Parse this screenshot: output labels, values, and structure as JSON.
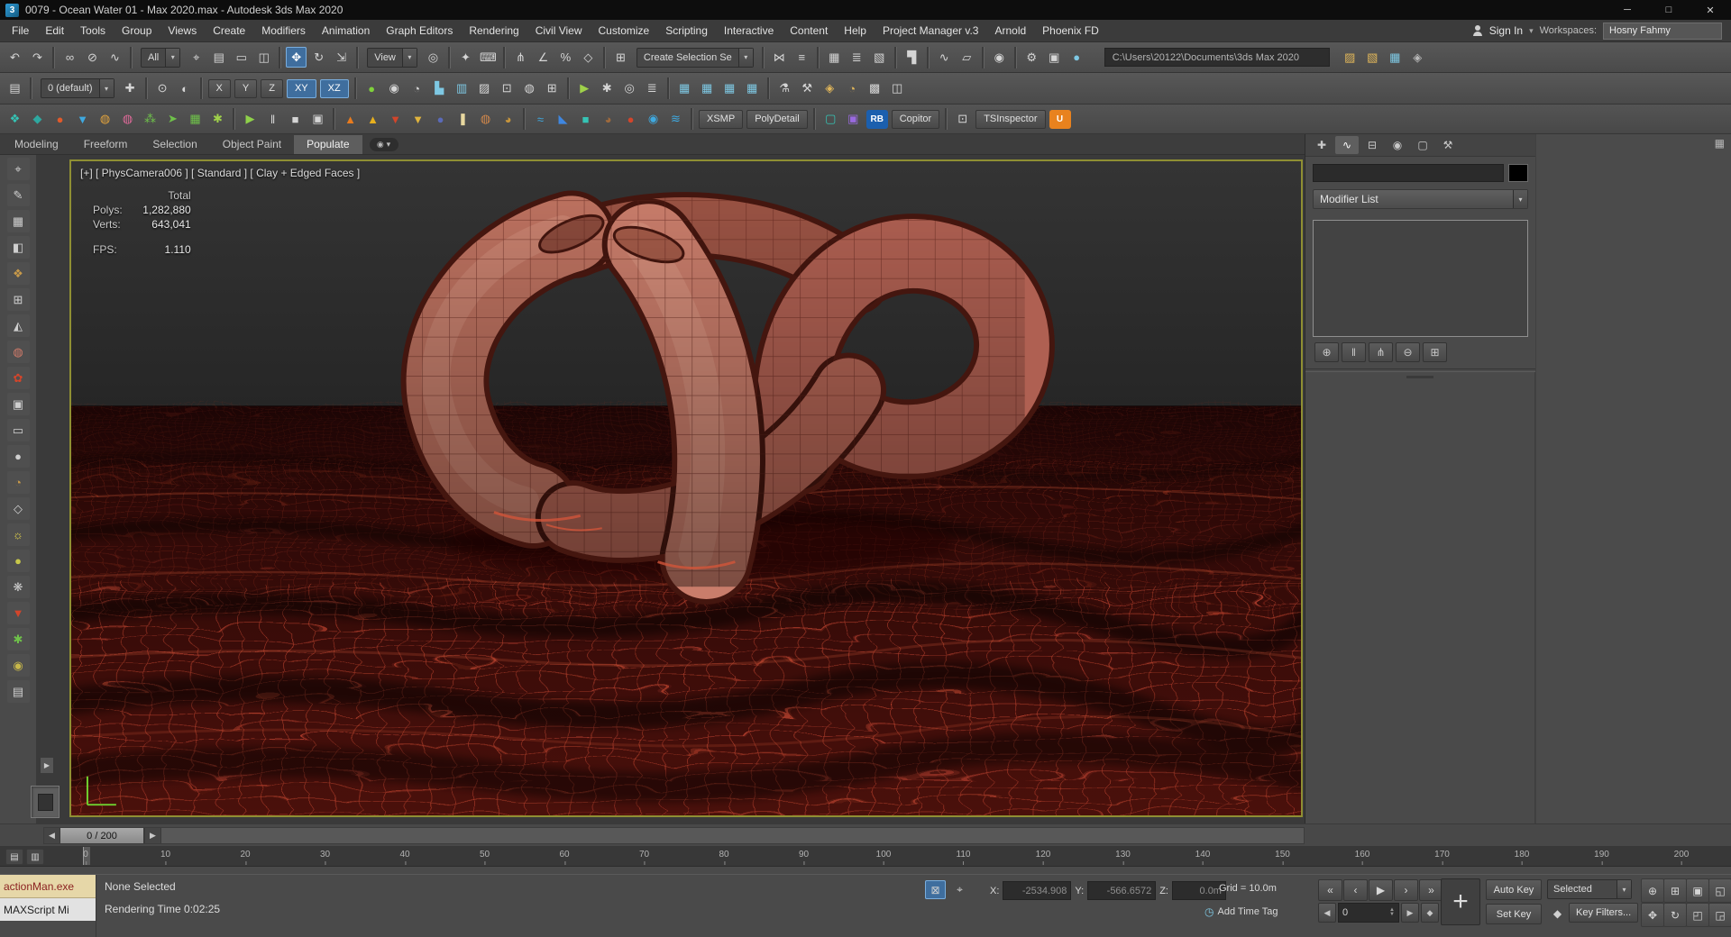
{
  "title_bar": {
    "title": "0079 - Ocean Water 01 - Max 2020.max - Autodesk 3ds Max 2020",
    "logo_glyph": "3"
  },
  "menu_bar": {
    "sign_in": "Sign In",
    "workspaces_label": "Workspaces:",
    "workspace_value": "Hosny Fahmy"
  },
  "toolbar": {
    "filter_value": "All",
    "ref_coord": "View",
    "named_sel": "Create Selection Se",
    "layer": "0 (default)",
    "path": "C:\\Users\\20122\\Documents\\3ds Max 2020"
  },
  "viewport": {
    "header": "[+] [ PhysCamera006 ] [ Standard ] [ Clay + Edged Faces ]",
    "stats": {
      "total_label": "Total",
      "polys_label": "Polys:",
      "polys": "1,282,880",
      "verts_label": "Verts:",
      "verts": "643,041",
      "fps_label": "FPS:",
      "fps": "1.110"
    }
  },
  "command_panel": {
    "modifier_list": "Modifier List"
  },
  "time_slider": {
    "value": "0 / 200"
  },
  "timeline": {
    "ticks": [
      "0",
      "10",
      "20",
      "30",
      "40",
      "50",
      "60",
      "70",
      "80",
      "90",
      "100",
      "110",
      "120",
      "130",
      "140",
      "150",
      "160",
      "170",
      "180",
      "190",
      "200"
    ]
  },
  "status_bar": {
    "listener_line1": "actionMan.exe",
    "listener_line2": "MAXScript Mi",
    "selection": "None Selected",
    "render_time": "Rendering Time 0:02:25",
    "x_label": "X:",
    "x_value": "-2534.908",
    "y_label": "Y:",
    "y_value": "-566.6572",
    "z_label": "Z:",
    "z_value": "0.0m",
    "grid_text": "Grid = 10.0m",
    "add_time_tag": "Add Time Tag",
    "auto_key": "Auto Key",
    "set_key": "Set Key",
    "selected": "Selected",
    "key_filters": "Key Filters...",
    "frame": "0",
    "big_plus": "+"
  },
  "icons": {
    "chevron": "▾",
    "left_arrow": "◀",
    "right_arrow": "▶",
    "dot": "◉",
    "grid": "▦",
    "expand": "▶",
    "clock": "◷",
    "key": "◆",
    "up": "▲",
    "down": "▼"
  },
  "colors": {
    "accent_blue": "#3f6e9e",
    "viewport_border": "#8f8f33",
    "ocean_red": "#c24530",
    "clay": "#c97d6b"
  },
  "strips": {
    "menu": [
      {
        "n": "menu-file",
        "g": "File"
      },
      {
        "n": "menu-edit",
        "g": "Edit"
      },
      {
        "n": "menu-tools",
        "g": "Tools"
      },
      {
        "n": "menu-group",
        "g": "Group"
      },
      {
        "n": "menu-views",
        "g": "Views"
      },
      {
        "n": "menu-create",
        "g": "Create"
      },
      {
        "n": "menu-modifiers",
        "g": "Modifiers"
      },
      {
        "n": "menu-animation",
        "g": "Animation"
      },
      {
        "n": "menu-graph-editors",
        "g": "Graph Editors"
      },
      {
        "n": "menu-rendering",
        "g": "Rendering"
      },
      {
        "n": "menu-civil-view",
        "g": "Civil View"
      },
      {
        "n": "menu-customize",
        "g": "Customize"
      },
      {
        "n": "menu-scripting",
        "g": "Scripting"
      },
      {
        "n": "menu-interactive",
        "g": "Interactive"
      },
      {
        "n": "menu-content",
        "g": "Content"
      },
      {
        "n": "menu-help",
        "g": "Help"
      },
      {
        "n": "menu-project-manager",
        "g": "Project Manager v.3"
      },
      {
        "n": "menu-arnold",
        "g": "Arnold"
      },
      {
        "n": "menu-phoenix-fd",
        "g": "Phoenix FD"
      }
    ],
    "window_buttons": [
      {
        "n": "minimize-button",
        "g": "─"
      },
      {
        "n": "maximize-button",
        "g": "□"
      },
      {
        "n": "close-button",
        "g": "✕"
      }
    ],
    "tb1a": [
      {
        "n": "undo-icon",
        "g": "↶"
      },
      {
        "n": "redo-icon",
        "g": "↷"
      },
      {
        "cls": "sep"
      },
      {
        "n": "select-and-link-icon",
        "g": "∞"
      },
      {
        "n": "unlink-selection-icon",
        "g": "⊘"
      },
      {
        "n": "bind-to-space-warp-icon",
        "g": "∿"
      },
      {
        "cls": "sep"
      }
    ],
    "tb1b": [
      {
        "n": "select-object-icon",
        "g": "⌖"
      },
      {
        "n": "select-by-name-icon",
        "g": "▤"
      },
      {
        "n": "rectangular-region-icon",
        "g": "▭"
      },
      {
        "n": "window-crossing-icon",
        "g": "◫"
      },
      {
        "cls": "sep"
      },
      {
        "n": "select-and-move-icon",
        "g": "✥",
        "a": true
      },
      {
        "n": "select-and-rotate-icon",
        "g": "↻"
      },
      {
        "n": "select-and-scale-icon",
        "g": "⇲"
      },
      {
        "cls": "sep"
      }
    ],
    "tb1c": [
      {
        "n": "use-pivot-center-icon",
        "g": "◎"
      },
      {
        "cls": "sep"
      },
      {
        "n": "select-and-manipulate-icon",
        "g": "✦"
      },
      {
        "n": "keyboard-override-icon",
        "g": "⌨"
      },
      {
        "cls": "sep"
      },
      {
        "n": "snap-toggle-icon",
        "g": "⋔"
      },
      {
        "n": "angle-snap-icon",
        "g": "∠"
      },
      {
        "n": "percent-snap-icon",
        "g": "%"
      },
      {
        "n": "spinner-snap-icon",
        "g": "◇"
      },
      {
        "cls": "sep"
      },
      {
        "n": "named-sets-icon",
        "g": "⊞"
      }
    ],
    "tb1d": [
      {
        "cls": "sep"
      },
      {
        "n": "mirror-icon",
        "g": "⋈"
      },
      {
        "n": "align-icon",
        "g": "≡"
      },
      {
        "cls": "sep"
      },
      {
        "n": "scene-explorer-icon",
        "g": "▦"
      },
      {
        "n": "layer-explorer-icon",
        "g": "≣"
      },
      {
        "n": "manage-layers-icon",
        "g": "▧"
      },
      {
        "cls": "sep"
      },
      {
        "n": "ribbon-toggle-icon",
        "g": "▜"
      },
      {
        "cls": "sep"
      },
      {
        "n": "curve-editor-icon",
        "g": "∿"
      },
      {
        "n": "schematic-view-icon",
        "g": "▱"
      },
      {
        "cls": "sep"
      },
      {
        "n": "material-editor-icon",
        "g": "◉"
      },
      {
        "cls": "sep"
      },
      {
        "n": "render-setup-icon",
        "g": "⚙"
      },
      {
        "n": "rendered-frame-icon",
        "g": "▣"
      },
      {
        "n": "render-icon",
        "g": "●",
        "c": "#7ec8e3"
      }
    ],
    "tb1e": [
      {
        "n": "folder-icon",
        "g": "▨",
        "c": "#e0b65a"
      },
      {
        "n": "open-file-icon",
        "g": "▧",
        "c": "#e0b65a"
      },
      {
        "n": "save-file-icon",
        "g": "▦",
        "c": "#7ec8e3"
      },
      {
        "n": "info-icon",
        "g": "◈",
        "c": "#b8b8b8"
      }
    ],
    "tb2a": [
      {
        "n": "scene-explorer-toggle-icon",
        "g": "▤"
      },
      {
        "cls": "sep"
      }
    ],
    "tb2b": [
      {
        "n": "create-layer-icon",
        "g": "✚"
      },
      {
        "cls": "sep"
      },
      {
        "n": "isolate-selection-icon",
        "g": "⊙"
      },
      {
        "n": "display-toggle-icon",
        "g": "◐"
      },
      {
        "cls": "sep"
      }
    ],
    "axis": [
      {
        "cls": "tbtn",
        "n": "x-axis-button",
        "g": "X"
      },
      {
        "cls": "tbtn",
        "n": "y-axis-button",
        "g": "Y"
      },
      {
        "cls": "tbtn",
        "n": "z-axis-button",
        "g": "Z"
      },
      {
        "cls": "tbtn",
        "n": "xy-plane-button",
        "g": "XY",
        "a": true
      },
      {
        "cls": "tbtn",
        "n": "xz-plane-button",
        "g": "XZ",
        "a": true
      }
    ],
    "tb2c": [
      {
        "cls": "sep"
      },
      {
        "n": "default-lights-icon",
        "g": "●",
        "c": "#7fd13b"
      },
      {
        "n": "tool-icon",
        "g": "◉"
      },
      {
        "n": "tool-icon",
        "g": "◔"
      },
      {
        "n": "chart-icon",
        "g": "▙",
        "c": "#7ec8e3"
      },
      {
        "n": "table-icon",
        "g": "▥",
        "c": "#7ec8e3"
      },
      {
        "n": "tool-icon",
        "g": "▨"
      },
      {
        "n": "tool-icon",
        "g": "⊡"
      },
      {
        "n": "tool-icon",
        "g": "◍"
      },
      {
        "n": "tool-icon",
        "g": "⊞"
      },
      {
        "cls": "sep"
      },
      {
        "n": "tool-icon",
        "g": "▶",
        "c": "#9fd14a"
      },
      {
        "n": "tool-icon",
        "g": "✱"
      },
      {
        "n": "tool-icon",
        "g": "◎"
      },
      {
        "n": "tool-icon",
        "g": "≣"
      },
      {
        "cls": "sep"
      },
      {
        "n": "table-icon",
        "g": "▦",
        "c": "#7ec8e3"
      },
      {
        "n": "table-icon",
        "g": "▦",
        "c": "#7ec8e3"
      },
      {
        "n": "table-icon",
        "g": "▦",
        "c": "#7ec8e3"
      },
      {
        "n": "table-icon",
        "g": "▦",
        "c": "#7ec8e3"
      },
      {
        "cls": "sep"
      },
      {
        "n": "tool-icon",
        "g": "⚗"
      },
      {
        "n": "tool-icon",
        "g": "⚒"
      },
      {
        "n": "tool-icon",
        "g": "◈",
        "c": "#e0b65a"
      },
      {
        "n": "tool-icon",
        "g": "◔",
        "c": "#e0b65a"
      },
      {
        "n": "tool-icon",
        "g": "▩"
      },
      {
        "n": "tool-icon",
        "g": "◫"
      }
    ],
    "tb3": [
      {
        "n": "phoenix-liquid-icon",
        "g": "❖",
        "c": "#35c4b5"
      },
      {
        "n": "phoenix-gem-icon",
        "g": "◆",
        "c": "#2ea8a0"
      },
      {
        "n": "fire-sphere-icon",
        "g": "●",
        "c": "#e05a2b"
      },
      {
        "n": "water-drop-icon",
        "g": "▼",
        "c": "#3fa9e0"
      },
      {
        "n": "gold-ring-icon",
        "g": "◍",
        "c": "#e0a23d"
      },
      {
        "n": "pink-ring-icon",
        "g": "◍",
        "c": "#e06a9a"
      },
      {
        "n": "crowd-green-icon",
        "g": "⁂",
        "c": "#6fc24a"
      },
      {
        "n": "flow-arrow-icon",
        "g": "➤",
        "c": "#6fc24a"
      },
      {
        "n": "green-grid-icon",
        "g": "▦",
        "c": "#6fc24a"
      },
      {
        "n": "burst-icon",
        "g": "✱",
        "c": "#9fd14a"
      },
      {
        "cls": "sep"
      },
      {
        "n": "play-icon",
        "g": "▶",
        "c": "#8fd14a"
      },
      {
        "n": "pause-icon",
        "g": "‖"
      },
      {
        "n": "stop-icon",
        "g": "■"
      },
      {
        "n": "trash-icon",
        "g": "▣"
      },
      {
        "cls": "sep"
      },
      {
        "n": "flame-icon",
        "g": "▲",
        "c": "#e87b1e"
      },
      {
        "n": "flame-gold-icon",
        "g": "▲",
        "c": "#e8b01e"
      },
      {
        "n": "drip-red-icon",
        "g": "▼",
        "c": "#d2452b"
      },
      {
        "n": "drip-gold-icon",
        "g": "▼",
        "c": "#e0b43d"
      },
      {
        "n": "bomb-icon",
        "g": "●",
        "c": "#5a6ab8"
      },
      {
        "n": "candle-icon",
        "g": "❚",
        "c": "#e8d8a0"
      },
      {
        "n": "donut-icon",
        "g": "◍",
        "c": "#d2884b"
      },
      {
        "n": "teapot-icon",
        "g": "◕",
        "c": "#c8963c"
      },
      {
        "cls": "sep"
      },
      {
        "n": "ocean-icon",
        "g": "≈",
        "c": "#3fa9e0"
      },
      {
        "n": "ship-icon",
        "g": "◣",
        "c": "#3f87e0"
      },
      {
        "n": "cube-teal-icon",
        "g": "■",
        "c": "#35c4b5"
      },
      {
        "n": "teapot-brown-icon",
        "g": "◕",
        "c": "#a06a3c"
      },
      {
        "n": "red-sphere-icon",
        "g": "●",
        "c": "#d2452b"
      },
      {
        "n": "globe-icon",
        "g": "◉",
        "c": "#3fa9e0"
      },
      {
        "n": "wave-icon",
        "g": "≋",
        "c": "#3fa9e0"
      },
      {
        "cls": "sep"
      },
      {
        "cls": "tbtn",
        "n": "xsmp-button",
        "g": "XSMP"
      },
      {
        "cls": "tbtn",
        "n": "polydetail-button",
        "g": "PolyDetail"
      },
      {
        "cls": "sep"
      },
      {
        "n": "monitor-icon",
        "g": "▢",
        "c": "#35c4b5"
      },
      {
        "n": "purple-tool-icon",
        "g": "▣",
        "c": "#9a6ae0"
      },
      {
        "cls": "logo",
        "n": "rb-logo",
        "g": "RB",
        "bg": "#1b5fae"
      },
      {
        "cls": "tbtn",
        "n": "copitor-button",
        "g": "Copitor"
      },
      {
        "cls": "sep"
      },
      {
        "n": "screen-icon",
        "g": "⊡"
      },
      {
        "cls": "tbtn",
        "n": "tsinspector-button",
        "g": "TSInspector"
      },
      {
        "cls": "logo",
        "n": "uniconvertor-logo",
        "g": "U",
        "bg": "#e8821e"
      }
    ],
    "ribbon_tabs": [
      {
        "n": "tab-modeling",
        "g": "Modeling"
      },
      {
        "n": "tab-freeform",
        "g": "Freeform"
      },
      {
        "n": "tab-selection",
        "g": "Selection"
      },
      {
        "n": "tab-object-paint",
        "g": "Object Paint"
      },
      {
        "n": "tab-populate",
        "g": "Populate",
        "a": true
      }
    ],
    "cp_tabs": [
      {
        "n": "tab-create",
        "g": "✚"
      },
      {
        "n": "tab-modify",
        "g": "∿",
        "a": true
      },
      {
        "n": "tab-hierarchy",
        "g": "⊟"
      },
      {
        "n": "tab-motion",
        "g": "◉"
      },
      {
        "n": "tab-display",
        "g": "▢"
      },
      {
        "n": "tab-utilities",
        "g": "⚒"
      }
    ],
    "stack_buttons": [
      {
        "n": "pin-stack-button",
        "g": "⊕"
      },
      {
        "n": "show-end-result-button",
        "g": "‖"
      },
      {
        "n": "make-unique-button",
        "g": "⋔"
      },
      {
        "n": "remove-modifier-button",
        "g": "⊖"
      },
      {
        "n": "configure-sets-button",
        "g": "⊞"
      }
    ],
    "left_tools": [
      {
        "n": "tool-icon",
        "g": "⌖"
      },
      {
        "n": "tool-icon",
        "g": "✎"
      },
      {
        "n": "tool-icon",
        "g": "▦"
      },
      {
        "n": "tool-icon",
        "g": "◧"
      },
      {
        "n": "tool-icon",
        "g": "❖",
        "c": "#c89a4a"
      },
      {
        "n": "tool-icon",
        "g": "⊞"
      },
      {
        "n": "tool-icon",
        "g": "◭"
      },
      {
        "n": "tool-icon",
        "g": "◍",
        "c": "#d27b6a"
      },
      {
        "n": "tool-icon",
        "g": "✿",
        "c": "#d2452b"
      },
      {
        "n": "tool-icon",
        "g": "▣"
      },
      {
        "n": "tool-icon",
        "g": "▭"
      },
      {
        "n": "tool-icon",
        "g": "●"
      },
      {
        "n": "tool-icon",
        "g": "◔",
        "c": "#c89a4a"
      },
      {
        "n": "tool-icon",
        "g": "◇"
      },
      {
        "n": "tool-icon",
        "g": "☼",
        "c": "#e8d84a"
      },
      {
        "n": "tool-icon",
        "g": "●",
        "c": "#c8c84a"
      },
      {
        "n": "tool-icon",
        "g": "❋"
      },
      {
        "n": "tool-icon",
        "g": "▼",
        "c": "#d2452b"
      },
      {
        "n": "tool-icon",
        "g": "✱",
        "c": "#6fc24a"
      },
      {
        "n": "tool-icon",
        "g": "◉",
        "c": "#c8b84a"
      },
      {
        "n": "tool-icon",
        "g": "▤"
      }
    ],
    "ruler_icons": [
      {
        "n": "mini-icon",
        "g": "▤"
      },
      {
        "n": "mini-icon",
        "g": "▥"
      }
    ],
    "locks": [
      {
        "n": "selection-lock-icon",
        "g": "⊠",
        "a": true
      },
      {
        "n": "offset-mode-icon",
        "g": "⌖"
      }
    ],
    "transport": [
      {
        "n": "go-to-start-button",
        "g": "«"
      },
      {
        "n": "previous-frame-button",
        "g": "‹"
      },
      {
        "n": "play-button",
        "g": "▶"
      },
      {
        "n": "next-frame-button",
        "g": "›"
      },
      {
        "n": "go-to-end-button",
        "g": "»"
      }
    ],
    "nav": [
      {
        "n": "zoom-icon",
        "g": "⊕"
      },
      {
        "n": "zoom-all-icon",
        "g": "⊞"
      },
      {
        "n": "zoom-extents-icon",
        "g": "▣"
      },
      {
        "n": "zoom-region-icon",
        "g": "◱"
      },
      {
        "n": "pan-icon",
        "g": "✥"
      },
      {
        "n": "orbit-icon",
        "g": "↻"
      },
      {
        "n": "fov-icon",
        "g": "◰"
      },
      {
        "n": "maximize-viewport-icon",
        "g": "◲"
      }
    ]
  }
}
